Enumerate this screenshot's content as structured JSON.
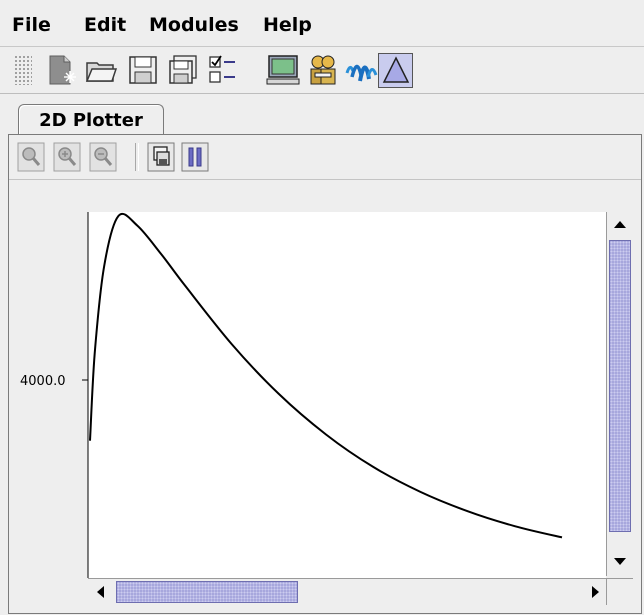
{
  "menu": {
    "file": "File",
    "edit": "Edit",
    "modules": "Modules",
    "help": "Help"
  },
  "toolbar": {
    "icons": [
      "new-document-icon",
      "open-folder-icon",
      "save-icon",
      "save-as-icon",
      "checklist-icon",
      "monitor-icon",
      "users-icon",
      "waves-icon",
      "triangle-module-icon"
    ]
  },
  "tabs": [
    {
      "label": "2D Plotter",
      "selected": true
    }
  ],
  "plotter_toolbar": {
    "icons": [
      "zoom-icon",
      "zoom-in-icon",
      "zoom-out-icon",
      "copy-icon",
      "pause-icon"
    ]
  },
  "chart_data": {
    "type": "line",
    "title": "",
    "xlabel": "",
    "ylabel": "",
    "y_ticks": [
      "4000.0"
    ],
    "series": [
      {
        "x": [
          0.0,
          0.01,
          0.03,
          0.06,
          0.1,
          0.15,
          0.2,
          0.3,
          0.4,
          0.5,
          0.6,
          0.7,
          0.8,
          0.9,
          1.0
        ],
        "y": [
          2200,
          3600,
          5000,
          5800,
          5650,
          5200,
          4700,
          3750,
          2950,
          2300,
          1780,
          1380,
          1070,
          830,
          650
        ]
      }
    ],
    "grid": false,
    "line_color": "#000000"
  },
  "scrollbars": {
    "vertical_position": 0.0,
    "horizontal_position": 0.0
  }
}
